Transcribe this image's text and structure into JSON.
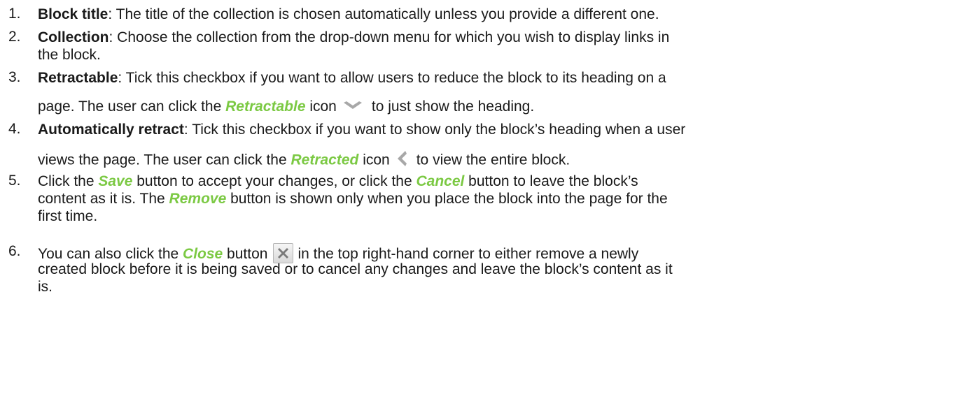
{
  "items": [
    {
      "num": "1.",
      "term": "Block title",
      "line1": ": The title of the collection is chosen automatically unless you provide a different one."
    },
    {
      "num": "2.",
      "term": "Collection",
      "line1": ": Choose the collection from the drop-down menu for which you wish to display links in",
      "line2": "the block."
    },
    {
      "num": "3.",
      "term": "Retractable",
      "line1": ": Tick this checkbox if you want to allow users to reduce the block to its heading on a",
      "line2_a": "page. The user can click the ",
      "ui": "Retractable",
      "line2_b": " icon",
      "line2_c": "to just show the heading."
    },
    {
      "num": "4.",
      "term": "Automatically retract",
      "line1": ": Tick this checkbox if you want to show only the block’s heading when a user",
      "line2_a": "views the page. The user can click the ",
      "ui": "Retracted",
      "line2_b": " icon",
      "line2_c": "to view the entire block."
    },
    {
      "num": "5.",
      "line1_a": "Click the ",
      "ui1": "Save",
      "line1_b": " button to accept your changes, or click the ",
      "ui2": "Cancel",
      "line1_c": " button to leave the block’s",
      "line2_a": "content as it is. The ",
      "ui3": "Remove",
      "line2_b": " button is shown only when you place the block into the page for the",
      "line3": "first time."
    },
    {
      "num": "6.",
      "line1_a": "You can also click the ",
      "ui": "Close",
      "line1_b": " button",
      "line1_c": "in the top right-hand corner to either remove a newly",
      "line2": "created block before it is being saved or to cancel any changes and leave the block’s content as it",
      "line3": "is."
    }
  ],
  "icons": {
    "retractable": "chevron-down-icon",
    "retracted": "chevron-left-icon",
    "close": "close-icon"
  },
  "colors": {
    "ui_term": "#7bc943",
    "icon_grey": "#a8a8a8"
  }
}
